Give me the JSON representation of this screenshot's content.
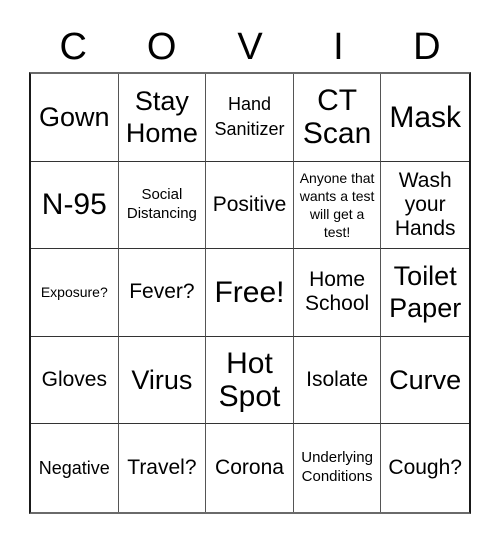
{
  "title_letters": [
    "C",
    "O",
    "V",
    "I",
    "D"
  ],
  "cells": [
    {
      "text": "Gown",
      "size": "lg"
    },
    {
      "text": "Stay Home",
      "size": "lg"
    },
    {
      "text": "Hand Sanitizer",
      "size": "sm"
    },
    {
      "text": "CT Scan",
      "size": "xl"
    },
    {
      "text": "Mask",
      "size": "xl"
    },
    {
      "text": "N-95",
      "size": "xl"
    },
    {
      "text": "Social Distancing",
      "size": "xs"
    },
    {
      "text": "Positive",
      "size": "md"
    },
    {
      "text": "Anyone that wants a test will get a test!",
      "size": "xxs"
    },
    {
      "text": "Wash your Hands",
      "size": "md"
    },
    {
      "text": "Exposure?",
      "size": "xxs"
    },
    {
      "text": "Fever?",
      "size": "md"
    },
    {
      "text": "Free!",
      "size": "xl"
    },
    {
      "text": "Home School",
      "size": "md"
    },
    {
      "text": "Toilet Paper",
      "size": "lg"
    },
    {
      "text": "Gloves",
      "size": "md"
    },
    {
      "text": "Virus",
      "size": "lg"
    },
    {
      "text": "Hot Spot",
      "size": "xl"
    },
    {
      "text": "Isolate",
      "size": "md"
    },
    {
      "text": "Curve",
      "size": "lg"
    },
    {
      "text": "Negative",
      "size": "sm"
    },
    {
      "text": "Travel?",
      "size": "md"
    },
    {
      "text": "Corona",
      "size": "md"
    },
    {
      "text": "Underlying Conditions",
      "size": "xs"
    },
    {
      "text": "Cough?",
      "size": "md"
    }
  ]
}
